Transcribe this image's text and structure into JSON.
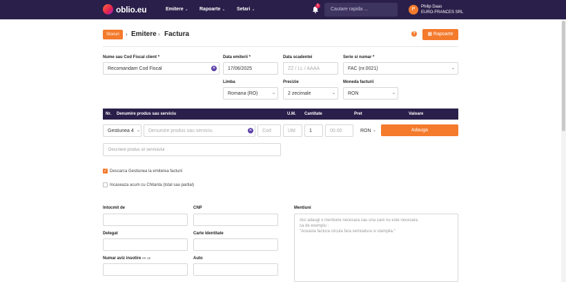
{
  "header": {
    "logo": "oblio.eu",
    "nav": [
      {
        "label": "Emitere"
      },
      {
        "label": "Rapoarte"
      },
      {
        "label": "Setari"
      }
    ],
    "notifications": "1",
    "search_placeholder": "Cautare rapida ...",
    "user": {
      "initial": "P",
      "name": "Philip Daas",
      "company": "EURO-FRANCES SRL"
    }
  },
  "breadcrumb": {
    "badge": "Stocuri",
    "section": "Emitere",
    "page": "Factura"
  },
  "actions": {
    "rapoarte": "Rapoarte",
    "help": "?"
  },
  "client": {
    "label": "Nume sau Cod Fiscal client *",
    "value": "Recomandam Cod Fiscal"
  },
  "invoice": {
    "date_label": "Data emiterii *",
    "date_value": "17/06/2025",
    "due_label": "Data scadentei",
    "due_placeholder": "ZZ / LL / AAAA",
    "series_label": "Serie si numar *",
    "series_value": "FAC (nr.0021)",
    "language_label": "Limba",
    "language_value": "Romana (RO)",
    "precision_label": "Precizie",
    "precision_value": "2 zecimale",
    "currency_label": "Moneda facturii",
    "currency_value": "RON"
  },
  "table": {
    "headers": [
      "Nr.",
      "Denumire produs sau serviciu",
      "U.M.",
      "Cantitate",
      "Pret",
      "Valoare"
    ],
    "row": {
      "management": "Gestiunea 4",
      "product_placeholder": "Denumire produs sau serviciu",
      "code_placeholder": "Cod",
      "um_placeholder": "UM",
      "quantity": "1",
      "price_placeholder": "00.00",
      "currency": "RON",
      "add_label": "Adauga"
    },
    "description_placeholder": "Descriere produs si/ serviciului"
  },
  "options": {
    "discount_label": "Descarca Gestiunea la emiterea facturii",
    "receipt_label": "Incaseaza acum cu Chitanta (total sau partial)"
  },
  "footer_fields": {
    "issued_by": "Intocmit de",
    "cnp": "CNP",
    "delegate": "Delegat",
    "id_card": "Carte Identitate",
    "notice_number": "Numar aviz insotire",
    "notice_suffix": "en us",
    "auto": "Auto",
    "mentions_label": "Mentiuni",
    "mentions_placeholder_1": "Aici adaugi o mentiune necesara sau una care nu este necesara",
    "mentions_placeholder_2": "ca de exemplu :",
    "mentions_placeholder_3": "\"Aceasta factura circula fara semnatura si stampila.\""
  }
}
